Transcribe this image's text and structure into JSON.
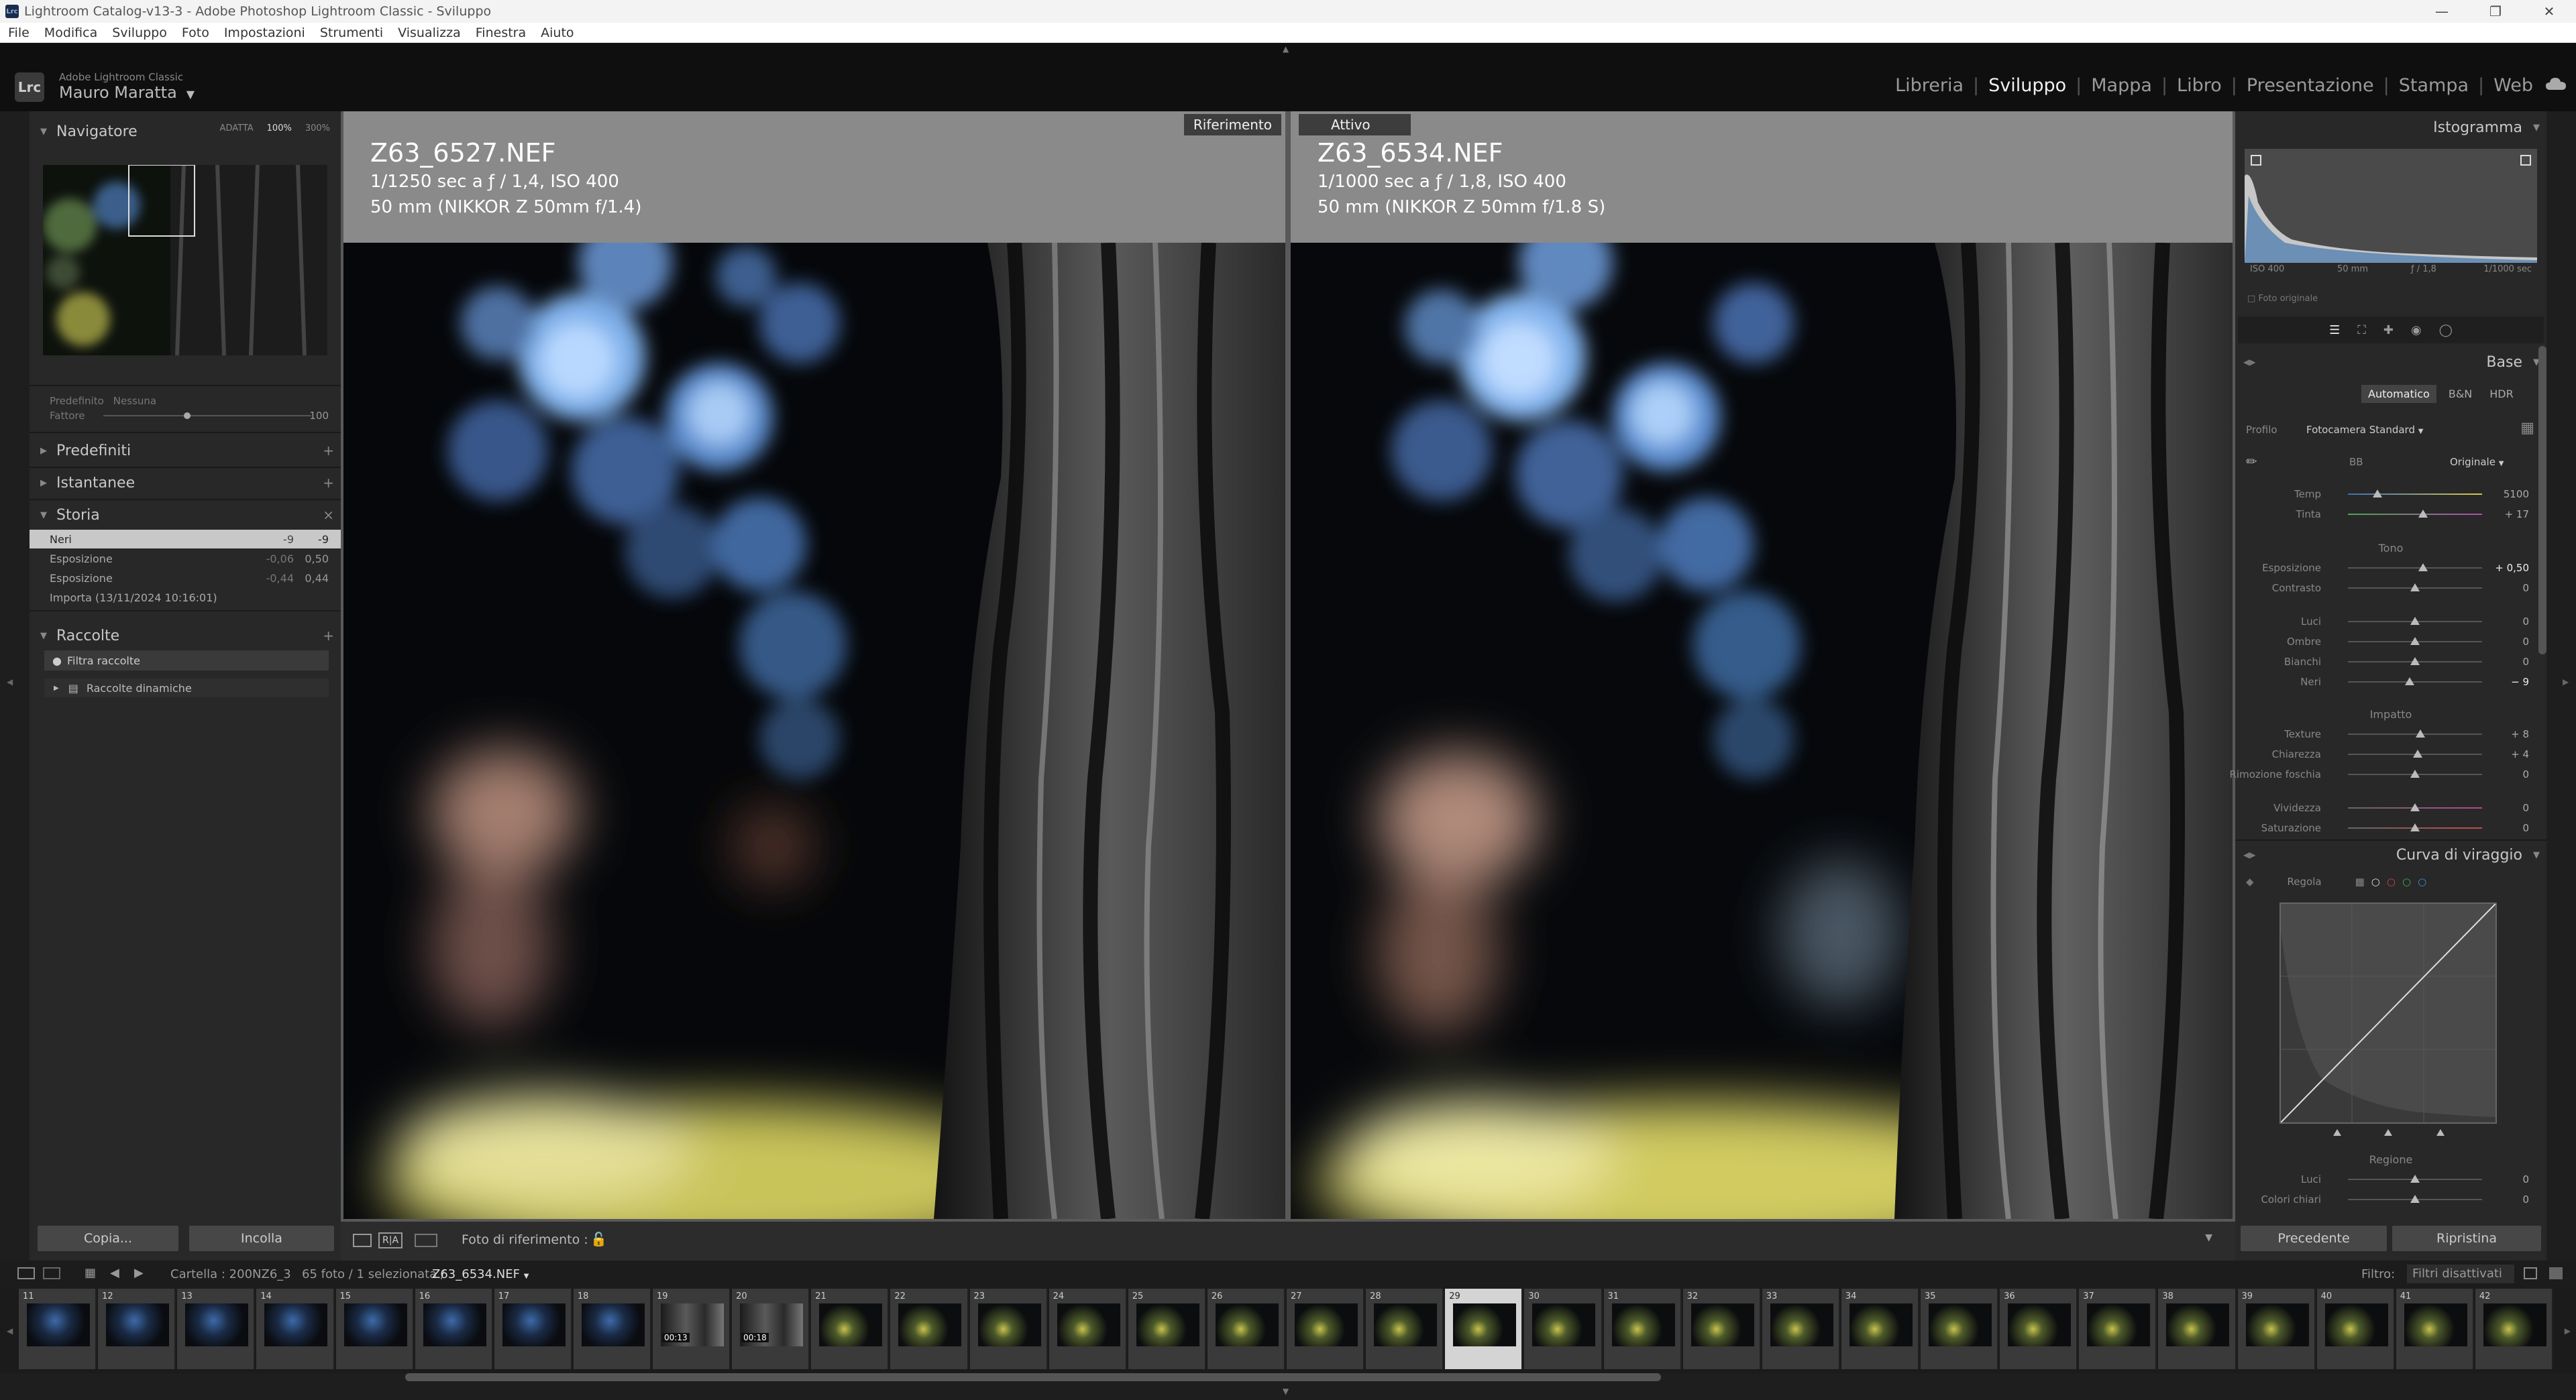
{
  "window": {
    "title": "Lightroom Catalog-v13-3 - Adobe Photoshop Lightroom Classic - Sviluppo",
    "app_icon": "Lrc"
  },
  "menu": [
    "File",
    "Modifica",
    "Sviluppo",
    "Foto",
    "Impostazioni",
    "Strumenti",
    "Visualizza",
    "Finestra",
    "Aiuto"
  ],
  "identity": {
    "badge": "Lrc",
    "product": "Adobe Lightroom Classic",
    "user": "Mauro Maratta"
  },
  "modules": [
    "Libreria",
    "Sviluppo",
    "Mappa",
    "Libro",
    "Presentazione",
    "Stampa",
    "Web"
  ],
  "active_module": "Sviluppo",
  "left": {
    "navigator": {
      "title": "Navigatore",
      "zoom": [
        "ADATTA",
        "100%",
        "300%"
      ],
      "zoom_selected": "100%"
    },
    "preset_amount": {
      "preset_label": "Predefinito",
      "preset_value": "Nessuna",
      "amount_label": "Fattore",
      "amount_value": "100"
    },
    "panels": {
      "presets": "Predefiniti",
      "snapshots": "Istantanee",
      "history": "Storia",
      "collections": "Raccolte"
    },
    "history": [
      {
        "name": "Neri",
        "v1": "-9",
        "v2": "-9",
        "selected": true
      },
      {
        "name": "Esposizione",
        "v1": "-0,06",
        "v2": "0,50"
      },
      {
        "name": "Esposizione",
        "v1": "-0,44",
        "v2": "0,44"
      },
      {
        "name": "Importa (13/11/2024 10:16:01)",
        "v1": "",
        "v2": ""
      }
    ],
    "collections": {
      "filter": "Filtra raccolte",
      "smart": "Raccolte dinamiche"
    },
    "copy_button": "Copia...",
    "paste_button": "Incolla"
  },
  "photos": {
    "reference": {
      "tag": "Riferimento",
      "filename": "Z63_6527.NEF",
      "exposure": "1/1250 sec a ƒ / 1,4, ISO 400",
      "lens": "50 mm (NIKKOR Z 50mm f/1.4)"
    },
    "active": {
      "tag": "Attivo",
      "filename": "Z63_6534.NEF",
      "exposure": "1/1000 sec a ƒ / 1,8, ISO 400",
      "lens": "50 mm (NIKKOR Z 50mm f/1.8 S)"
    }
  },
  "toolbar": {
    "compare_label": "R|A",
    "ref_label": "Foto di riferimento :"
  },
  "right": {
    "histogram": {
      "title": "Istogramma",
      "iso": "ISO 400",
      "focal": "50 mm",
      "aperture": "ƒ / 1,8",
      "shutter": "1/1000 sec",
      "original_label": "Foto originale"
    },
    "basic": {
      "title": "Base",
      "treatment": [
        "Automatico",
        "B&N",
        "HDR"
      ],
      "profile_label": "Profilo",
      "profile_value": "Fotocamera Standard",
      "wb_label": "BB",
      "wb_value": "Originale",
      "temp": {
        "label": "Temp",
        "value": "5100",
        "level": 0.22
      },
      "tint": {
        "label": "Tinta",
        "value": "+ 17",
        "level": 0.56
      },
      "tone_title": "Tono",
      "exposure": {
        "label": "Esposizione",
        "value": "+ 0,50",
        "level": 0.56
      },
      "contrast": {
        "label": "Contrasto",
        "value": "0",
        "level": 0.5
      },
      "highlights": {
        "label": "Luci",
        "value": "0",
        "level": 0.5
      },
      "shadows": {
        "label": "Ombre",
        "value": "0",
        "level": 0.5
      },
      "whites": {
        "label": "Bianchi",
        "value": "0",
        "level": 0.5
      },
      "blacks": {
        "label": "Neri",
        "value": "− 9",
        "level": 0.46
      },
      "presence_title": "Impatto",
      "texture": {
        "label": "Texture",
        "value": "+ 8",
        "level": 0.54
      },
      "clarity": {
        "label": "Chiarezza",
        "value": "+ 4",
        "level": 0.52
      },
      "dehaze": {
        "label": "Rimozione foschia",
        "value": "0",
        "level": 0.5
      },
      "vibrance": {
        "label": "Vividezza",
        "value": "0",
        "level": 0.5
      },
      "saturation": {
        "label": "Saturazione",
        "value": "0",
        "level": 0.5
      }
    },
    "tone_curve": {
      "title": "Curva di viraggio",
      "adjust_label": "Regola",
      "region_title": "Regione",
      "highlights": {
        "label": "Luci",
        "value": "0"
      },
      "lights": {
        "label": "Colori chiari",
        "value": "0"
      }
    },
    "prev_button": "Precedente",
    "reset_button": "Ripristina"
  },
  "filmbar": {
    "folder": "Cartella : 200NZ6_3",
    "count": "65 foto / 1 selezionata /",
    "file": "Z63_6534.NEF",
    "filter_label": "Filtro:",
    "filter_value": "Filtri disattivati"
  },
  "filmstrip": {
    "numbers": [
      "11",
      "12",
      "13",
      "14",
      "15",
      "16",
      "17",
      "18",
      "19",
      "20",
      "21",
      "22",
      "23",
      "24",
      "25",
      "26",
      "27",
      "28",
      "29",
      "30",
      "31",
      "32",
      "33",
      "34",
      "35",
      "36",
      "37",
      "38",
      "39",
      "40",
      "41",
      "42"
    ],
    "selected": "29",
    "durations": {
      "19": "00:13",
      "20": "00:18"
    }
  }
}
